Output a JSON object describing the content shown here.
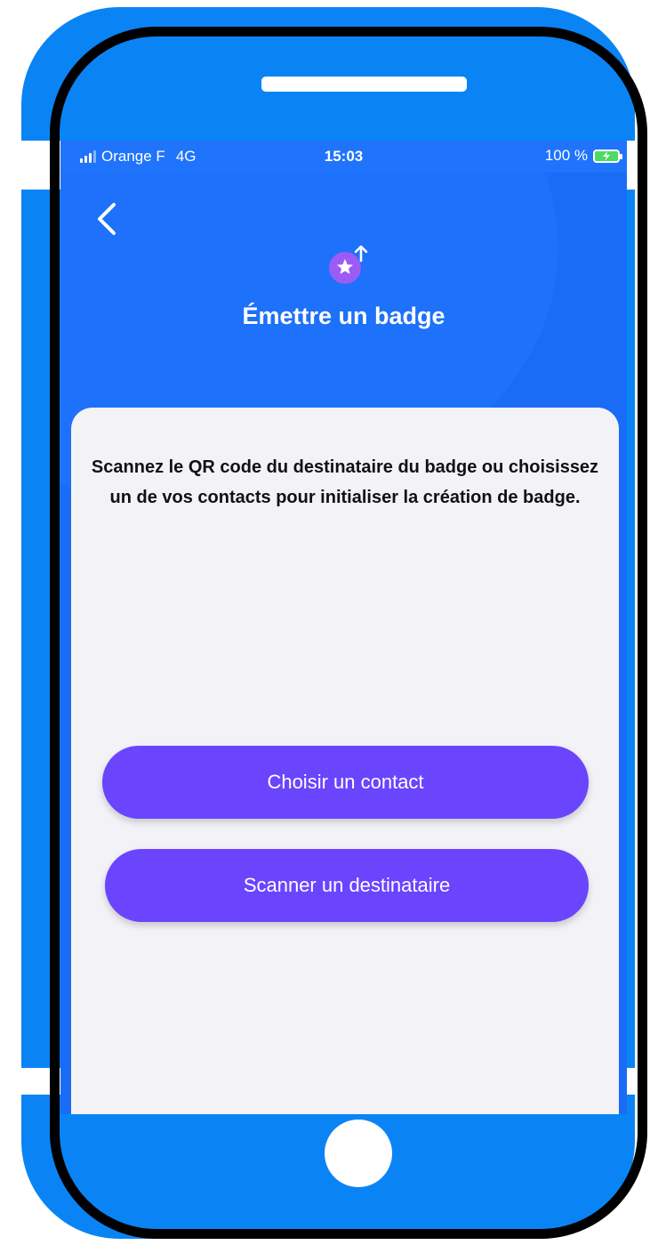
{
  "status_bar": {
    "carrier": "Orange F",
    "network": "4G",
    "time": "15:03",
    "battery_percent": "100 %"
  },
  "header": {
    "title": "Émettre un badge",
    "icon": "badge-star-upload-icon"
  },
  "card": {
    "instructions": "Scannez le QR code du destinataire du badge ou choisissez un de vos contacts pour initialiser la création de badge."
  },
  "buttons": {
    "choose_contact": "Choisir un contact",
    "scan_recipient": "Scanner un destinataire"
  },
  "colors": {
    "header_blue": "#1a6cf7",
    "phone_frame_blue": "#0a84f5",
    "button_purple": "#6b44fe",
    "highlight_pink": "#f9a8f7",
    "card_background": "#f3f3f7",
    "badge_icon_purple": "#9b5cf6"
  }
}
